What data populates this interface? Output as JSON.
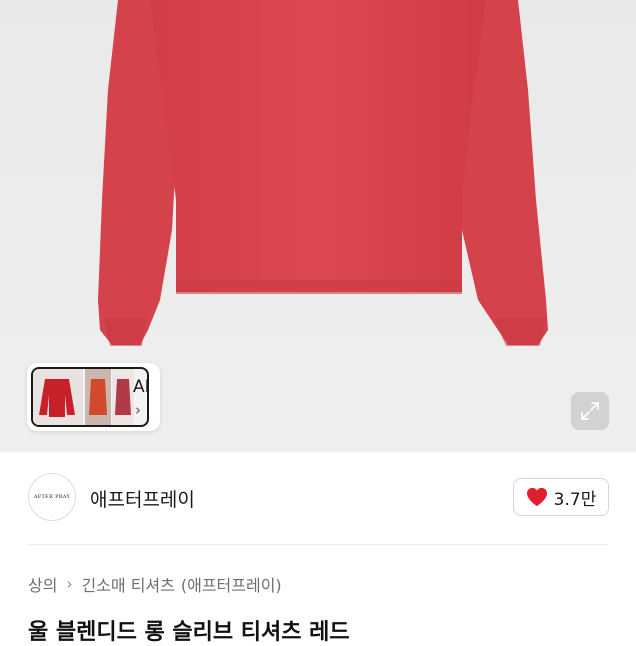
{
  "hero": {
    "shirt_color": "#d9454d",
    "thumbnail": {
      "ai_label": "AI",
      "chevron_icon": "chevron-right-icon"
    },
    "expand_icon": "expand-arrows-icon"
  },
  "seller": {
    "logo_text": "AFTER PRAY",
    "name": "애프터프레이",
    "likes": "3.7만",
    "like_icon": "heart-icon",
    "like_color": "#e0202d"
  },
  "breadcrumb": {
    "category": "상의",
    "subcategory": "긴소매 티셔츠",
    "brand": "(애프터프레이)"
  },
  "product": {
    "title": "울 블렌디드 롱 슬리브 티셔츠 레드"
  }
}
